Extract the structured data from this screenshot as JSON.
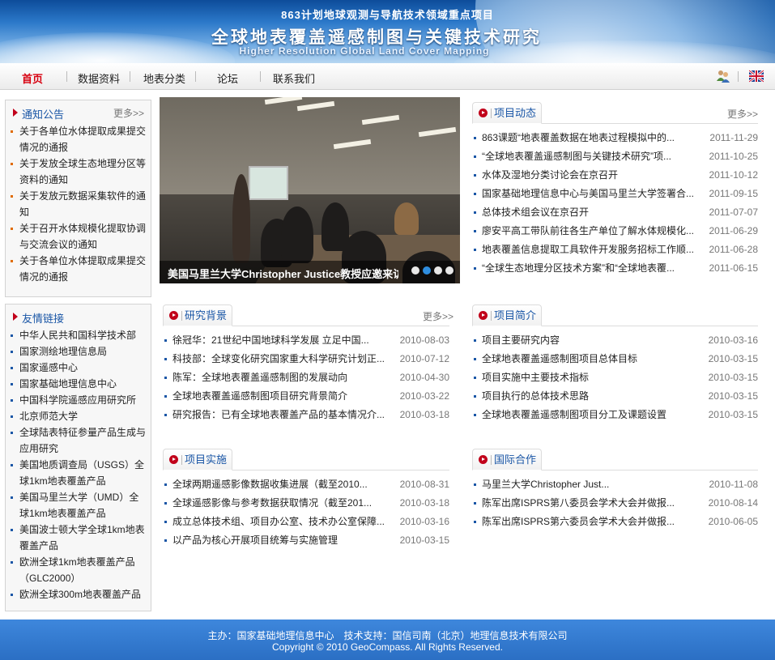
{
  "banner": {
    "program": "863计划地球观测与导航技术领域重点项目",
    "title": "全球地表覆盖遥感制图与关键技术研究",
    "english": "Higher Resolution Global Land Cover Mapping"
  },
  "nav": {
    "items": [
      "首页",
      "数据资料",
      "地表分类",
      "论坛",
      "联系我们"
    ]
  },
  "notice": {
    "title": "通知公告",
    "more": "更多>>",
    "items": [
      "关于各单位水体提取成果提交情况的通报",
      "关于发放全球生态地理分区等资料的通知",
      "关于发放元数据采集软件的通知",
      "关于召开水体规模化提取协调与交流会议的通知",
      "关于各单位水体提取成果提交情况的通报"
    ]
  },
  "links": {
    "title": "友情链接",
    "items": [
      "中华人民共和国科学技术部",
      "国家测绘地理信息局",
      "国家遥感中心",
      "国家基础地理信息中心",
      "中国科学院遥感应用研究所",
      "北京师范大学",
      "全球陆表特征参量产品生成与应用研究",
      "美国地质调查局（USGS）全球1km地表覆盖产品",
      "美国马里兰大学（UMD）全球1km地表覆盖产品",
      "美国波士顿大学全球1km地表覆盖产品",
      "欧洲全球1km地表覆盖产品（GLC2000）",
      "欧洲全球300m地表覆盖产品"
    ]
  },
  "photo": {
    "caption": "美国马里兰大学Christopher Justice教授应邀来访",
    "slide_count": 4,
    "active_slide": 2
  },
  "news": {
    "title": "项目动态",
    "more": "更多>>",
    "items": [
      {
        "text": "863课题“地表覆盖数据在地表过程模拟中的...",
        "date": "2011-11-29"
      },
      {
        "text": "“全球地表覆盖遥感制图与关键技术研究”项...",
        "date": "2011-10-25"
      },
      {
        "text": "水体及湿地分类讨论会在京召开",
        "date": "2011-10-12"
      },
      {
        "text": "国家基础地理信息中心与美国马里兰大学签署合...",
        "date": "2011-09-15"
      },
      {
        "text": "总体技术组会议在京召开",
        "date": "2011-07-07"
      },
      {
        "text": "廖安平高工带队前往各生产单位了解水体规模化...",
        "date": "2011-06-29"
      },
      {
        "text": "地表覆盖信息提取工具软件开发服务招标工作顺...",
        "date": "2011-06-28"
      },
      {
        "text": "“全球生态地理分区技术方案”和“全球地表覆...",
        "date": "2011-06-15"
      }
    ]
  },
  "background": {
    "title": "研究背景",
    "more": "更多>>",
    "items": [
      {
        "text": "徐冠华：21世纪中国地球科学发展 立足中国...",
        "date": "2010-08-03"
      },
      {
        "text": "科技部：全球变化研究国家重大科学研究计划正...",
        "date": "2010-07-12"
      },
      {
        "text": "陈军：全球地表覆盖遥感制图的发展动向",
        "date": "2010-04-30"
      },
      {
        "text": "全球地表覆盖遥感制图项目研究背景简介",
        "date": "2010-03-22"
      },
      {
        "text": "研究报告：已有全球地表覆盖产品的基本情况介...",
        "date": "2010-03-18"
      }
    ]
  },
  "intro": {
    "title": "项目简介",
    "items": [
      {
        "text": "项目主要研究内容",
        "date": "2010-03-16"
      },
      {
        "text": "全球地表覆盖遥感制图项目总体目标",
        "date": "2010-03-15"
      },
      {
        "text": "项目实施中主要技术指标",
        "date": "2010-03-15"
      },
      {
        "text": "项目执行的总体技术思路",
        "date": "2010-03-15"
      },
      {
        "text": "全球地表覆盖遥感制图项目分工及课题设置",
        "date": "2010-03-15"
      }
    ]
  },
  "implementation": {
    "title": "项目实施",
    "items": [
      {
        "text": "全球两期遥感影像数据收集进展（截至2010...",
        "date": "2010-08-31"
      },
      {
        "text": "全球遥感影像与参考数据获取情况（截至201...",
        "date": "2010-03-18"
      },
      {
        "text": "成立总体技术组、项目办公室、技术办公室保障...",
        "date": "2010-03-16"
      },
      {
        "text": "以产品为核心开展项目统筹与实施管理",
        "date": "2010-03-15"
      }
    ]
  },
  "intl": {
    "title": "国际合作",
    "items": [
      {
        "text": "马里兰大学Christopher Just...",
        "date": "2010-11-08"
      },
      {
        "text": "陈军出席ISPRS第八委员会学术大会并做报...",
        "date": "2010-08-14"
      },
      {
        "text": "陈军出席ISPRS第六委员会学术大会并做报...",
        "date": "2010-06-05"
      }
    ]
  },
  "footer": {
    "line1": "主办：国家基础地理信息中心　技术支持：国信司南（北京）地理信息技术有限公司",
    "line2": "Copyright © 2010 GeoCompass. All Rights Reserved."
  },
  "colors": {
    "accent_red": "#c1001a",
    "link_blue": "#1a56a6",
    "footer_blue": "#3a82d8"
  }
}
